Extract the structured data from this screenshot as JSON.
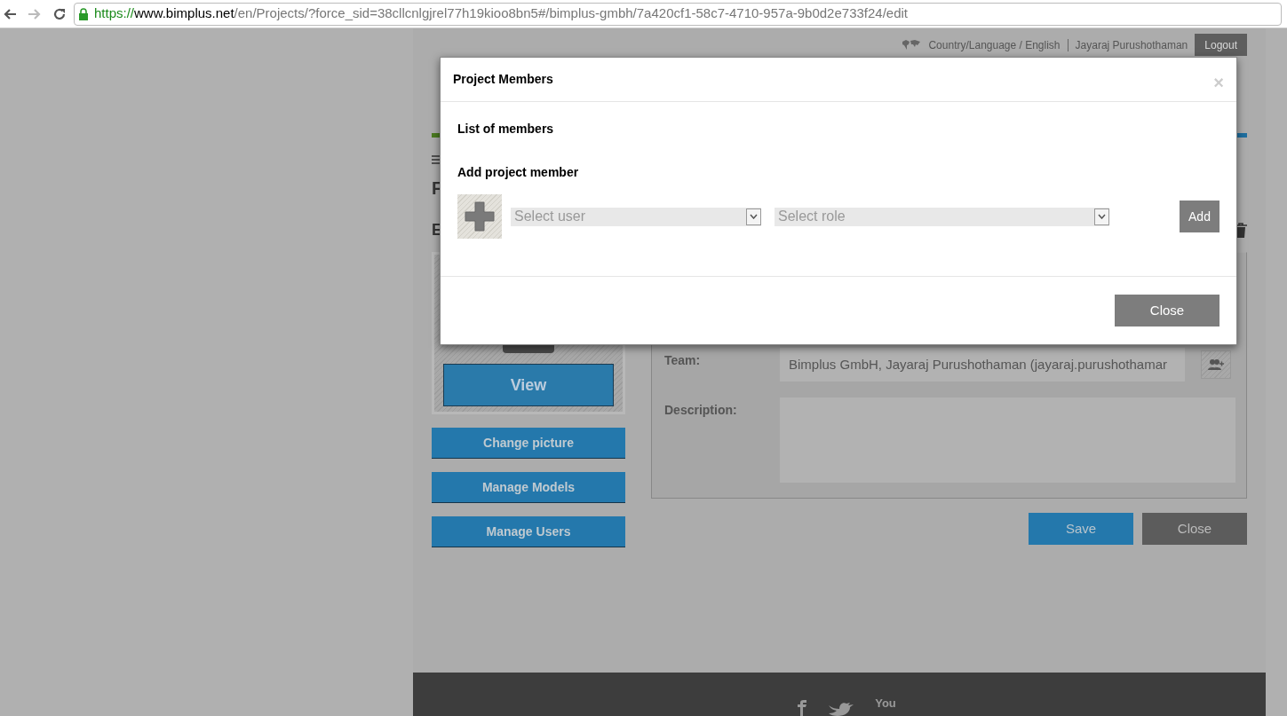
{
  "browser": {
    "url_scheme": "https://",
    "url_host": "www.bimplus.net",
    "url_path": "/en/Projects/?force_sid=38cllcnlgjrel77h19kioo8bn5#/bimplus-gmbh/7a420cf1-58c7-4710-957a-9b0d2e733f24/edit"
  },
  "top_bar": {
    "language_link": "Country/Language / English",
    "user": "Jayaraj Purushothaman",
    "logout": "Logout"
  },
  "page": {
    "heading_1": "F",
    "heading_2": "E",
    "picture_button": "View",
    "actions": [
      "Change picture",
      "Manage Models",
      "Manage Users"
    ],
    "fields": [
      {
        "kind": "text",
        "label": "Team:",
        "value": "Bimplus GmbH, Jayaraj Purushothaman (jayaraj.purushothamar"
      },
      {
        "kind": "textarea",
        "label": "Description:"
      }
    ],
    "buttons": [
      {
        "kind": "primary",
        "label": "Save"
      },
      {
        "kind": "secondary",
        "label": "Close"
      }
    ]
  },
  "modal": {
    "title": "Project Members",
    "close_glyph": "×",
    "sections": [
      "List of members",
      "Add project member"
    ],
    "user_select": {
      "placeholder": "Select user"
    },
    "role_select": {
      "placeholder": "Select role"
    },
    "add_button": "Add",
    "close_button": "Close"
  },
  "footer": {
    "youtube_label": "You"
  }
}
